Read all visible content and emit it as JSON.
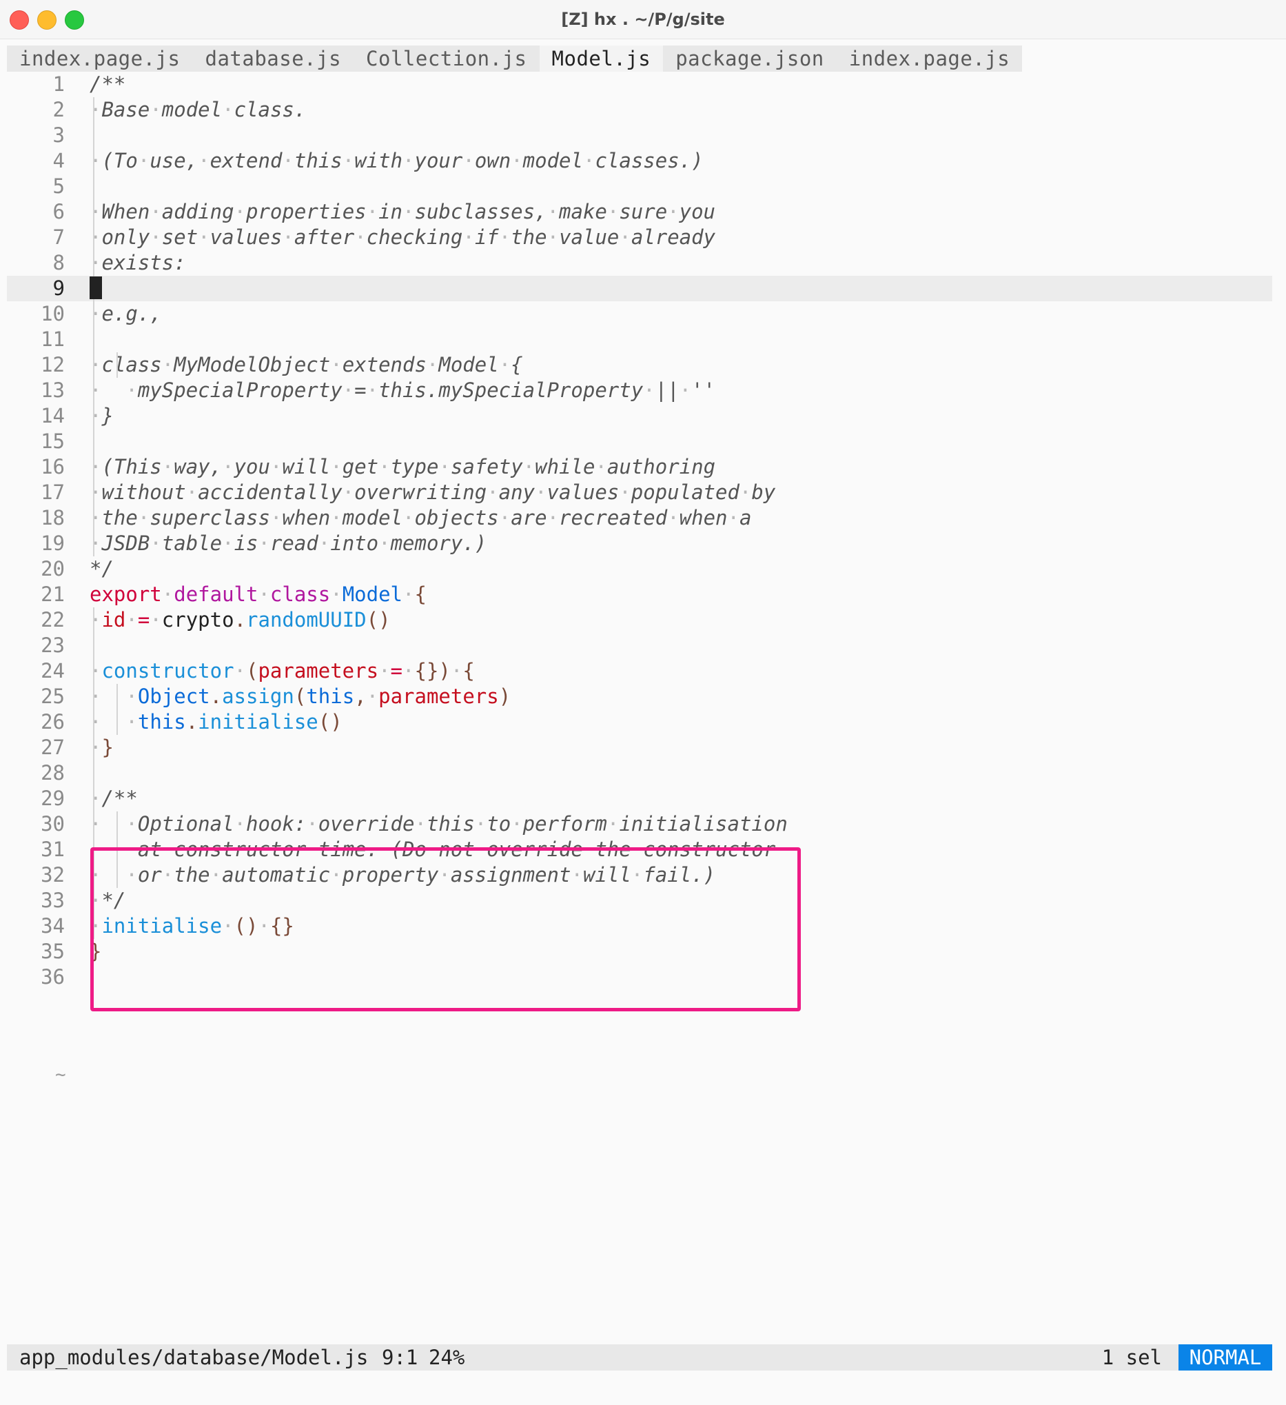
{
  "window": {
    "title": "[Z] hx . ~/P/g/site"
  },
  "tabs": [
    {
      "label": "index.page.js",
      "active": false
    },
    {
      "label": "database.js",
      "active": false
    },
    {
      "label": "Collection.js",
      "active": false
    },
    {
      "label": "Model.js",
      "active": true
    },
    {
      "label": "package.json",
      "active": false
    },
    {
      "label": "index.page.js",
      "active": false
    }
  ],
  "editor": {
    "cursor_line": 9,
    "line_numbers": [
      "1",
      "2",
      "3",
      "4",
      "5",
      "6",
      "7",
      "8",
      "9",
      "10",
      "11",
      "12",
      "13",
      "14",
      "15",
      "16",
      "17",
      "18",
      "19",
      "20",
      "21",
      "22",
      "23",
      "24",
      "25",
      "26",
      "27",
      "28",
      "29",
      "30",
      "31",
      "32",
      "33",
      "34",
      "35",
      "36"
    ],
    "empty_marker": "~",
    "lines": [
      [
        {
          "t": "/**",
          "c": "comment"
        }
      ],
      [
        {
          "t": "·",
          "c": "ws"
        },
        {
          "t": "Base",
          "c": "comment"
        },
        {
          "t": "·",
          "c": "ws"
        },
        {
          "t": "model",
          "c": "comment"
        },
        {
          "t": "·",
          "c": "ws"
        },
        {
          "t": "class.",
          "c": "comment"
        }
      ],
      [],
      [
        {
          "t": "·",
          "c": "ws"
        },
        {
          "t": "(To",
          "c": "comment"
        },
        {
          "t": "·",
          "c": "ws"
        },
        {
          "t": "use,",
          "c": "comment"
        },
        {
          "t": "·",
          "c": "ws"
        },
        {
          "t": "extend",
          "c": "comment"
        },
        {
          "t": "·",
          "c": "ws"
        },
        {
          "t": "this",
          "c": "comment"
        },
        {
          "t": "·",
          "c": "ws"
        },
        {
          "t": "with",
          "c": "comment"
        },
        {
          "t": "·",
          "c": "ws"
        },
        {
          "t": "your",
          "c": "comment"
        },
        {
          "t": "·",
          "c": "ws"
        },
        {
          "t": "own",
          "c": "comment"
        },
        {
          "t": "·",
          "c": "ws"
        },
        {
          "t": "model",
          "c": "comment"
        },
        {
          "t": "·",
          "c": "ws"
        },
        {
          "t": "classes.)",
          "c": "comment"
        }
      ],
      [],
      [
        {
          "t": "·",
          "c": "ws"
        },
        {
          "t": "When",
          "c": "comment"
        },
        {
          "t": "·",
          "c": "ws"
        },
        {
          "t": "adding",
          "c": "comment"
        },
        {
          "t": "·",
          "c": "ws"
        },
        {
          "t": "properties",
          "c": "comment"
        },
        {
          "t": "·",
          "c": "ws"
        },
        {
          "t": "in",
          "c": "comment"
        },
        {
          "t": "·",
          "c": "ws"
        },
        {
          "t": "subclasses,",
          "c": "comment"
        },
        {
          "t": "·",
          "c": "ws"
        },
        {
          "t": "make",
          "c": "comment"
        },
        {
          "t": "·",
          "c": "ws"
        },
        {
          "t": "sure",
          "c": "comment"
        },
        {
          "t": "·",
          "c": "ws"
        },
        {
          "t": "you",
          "c": "comment"
        }
      ],
      [
        {
          "t": "·",
          "c": "ws"
        },
        {
          "t": "only",
          "c": "comment"
        },
        {
          "t": "·",
          "c": "ws"
        },
        {
          "t": "set",
          "c": "comment"
        },
        {
          "t": "·",
          "c": "ws"
        },
        {
          "t": "values",
          "c": "comment"
        },
        {
          "t": "·",
          "c": "ws"
        },
        {
          "t": "after",
          "c": "comment"
        },
        {
          "t": "·",
          "c": "ws"
        },
        {
          "t": "checking",
          "c": "comment"
        },
        {
          "t": "·",
          "c": "ws"
        },
        {
          "t": "if",
          "c": "comment"
        },
        {
          "t": "·",
          "c": "ws"
        },
        {
          "t": "the",
          "c": "comment"
        },
        {
          "t": "·",
          "c": "ws"
        },
        {
          "t": "value",
          "c": "comment"
        },
        {
          "t": "·",
          "c": "ws"
        },
        {
          "t": "already",
          "c": "comment"
        }
      ],
      [
        {
          "t": "·",
          "c": "ws"
        },
        {
          "t": "exists:",
          "c": "comment"
        }
      ],
      [],
      [
        {
          "t": "·",
          "c": "ws"
        },
        {
          "t": "e.g.,",
          "c": "comment"
        }
      ],
      [],
      [
        {
          "t": "·",
          "c": "ws"
        },
        {
          "t": "class",
          "c": "comment"
        },
        {
          "t": "·",
          "c": "ws"
        },
        {
          "t": "MyModelObject",
          "c": "comment"
        },
        {
          "t": "·",
          "c": "ws"
        },
        {
          "t": "extends",
          "c": "comment"
        },
        {
          "t": "·",
          "c": "ws"
        },
        {
          "t": "Model",
          "c": "comment"
        },
        {
          "t": "·",
          "c": "ws"
        },
        {
          "t": "{",
          "c": "comment"
        }
      ],
      [
        {
          "t": "·",
          "c": "ws"
        },
        {
          "t": "  ",
          "c": "ws"
        },
        {
          "t": "·",
          "c": "ws"
        },
        {
          "t": "mySpecialProperty",
          "c": "comment"
        },
        {
          "t": "·",
          "c": "ws"
        },
        {
          "t": "=",
          "c": "comment"
        },
        {
          "t": "·",
          "c": "ws"
        },
        {
          "t": "this.mySpecialProperty",
          "c": "comment"
        },
        {
          "t": "·",
          "c": "ws"
        },
        {
          "t": "||",
          "c": "comment"
        },
        {
          "t": "·",
          "c": "ws"
        },
        {
          "t": "''",
          "c": "comment"
        }
      ],
      [
        {
          "t": "·",
          "c": "ws"
        },
        {
          "t": "}",
          "c": "comment"
        }
      ],
      [],
      [
        {
          "t": "·",
          "c": "ws"
        },
        {
          "t": "(This",
          "c": "comment"
        },
        {
          "t": "·",
          "c": "ws"
        },
        {
          "t": "way,",
          "c": "comment"
        },
        {
          "t": "·",
          "c": "ws"
        },
        {
          "t": "you",
          "c": "comment"
        },
        {
          "t": "·",
          "c": "ws"
        },
        {
          "t": "will",
          "c": "comment"
        },
        {
          "t": "·",
          "c": "ws"
        },
        {
          "t": "get",
          "c": "comment"
        },
        {
          "t": "·",
          "c": "ws"
        },
        {
          "t": "type",
          "c": "comment"
        },
        {
          "t": "·",
          "c": "ws"
        },
        {
          "t": "safety",
          "c": "comment"
        },
        {
          "t": "·",
          "c": "ws"
        },
        {
          "t": "while",
          "c": "comment"
        },
        {
          "t": "·",
          "c": "ws"
        },
        {
          "t": "authoring",
          "c": "comment"
        }
      ],
      [
        {
          "t": "·",
          "c": "ws"
        },
        {
          "t": "without",
          "c": "comment"
        },
        {
          "t": "·",
          "c": "ws"
        },
        {
          "t": "accidentally",
          "c": "comment"
        },
        {
          "t": "·",
          "c": "ws"
        },
        {
          "t": "overwriting",
          "c": "comment"
        },
        {
          "t": "·",
          "c": "ws"
        },
        {
          "t": "any",
          "c": "comment"
        },
        {
          "t": "·",
          "c": "ws"
        },
        {
          "t": "values",
          "c": "comment"
        },
        {
          "t": "·",
          "c": "ws"
        },
        {
          "t": "populated",
          "c": "comment"
        },
        {
          "t": "·",
          "c": "ws"
        },
        {
          "t": "by",
          "c": "comment"
        }
      ],
      [
        {
          "t": "·",
          "c": "ws"
        },
        {
          "t": "the",
          "c": "comment"
        },
        {
          "t": "·",
          "c": "ws"
        },
        {
          "t": "superclass",
          "c": "comment"
        },
        {
          "t": "·",
          "c": "ws"
        },
        {
          "t": "when",
          "c": "comment"
        },
        {
          "t": "·",
          "c": "ws"
        },
        {
          "t": "model",
          "c": "comment"
        },
        {
          "t": "·",
          "c": "ws"
        },
        {
          "t": "objects",
          "c": "comment"
        },
        {
          "t": "·",
          "c": "ws"
        },
        {
          "t": "are",
          "c": "comment"
        },
        {
          "t": "·",
          "c": "ws"
        },
        {
          "t": "recreated",
          "c": "comment"
        },
        {
          "t": "·",
          "c": "ws"
        },
        {
          "t": "when",
          "c": "comment"
        },
        {
          "t": "·",
          "c": "ws"
        },
        {
          "t": "a",
          "c": "comment"
        }
      ],
      [
        {
          "t": "·",
          "c": "ws"
        },
        {
          "t": "JSDB",
          "c": "comment"
        },
        {
          "t": "·",
          "c": "ws"
        },
        {
          "t": "table",
          "c": "comment"
        },
        {
          "t": "·",
          "c": "ws"
        },
        {
          "t": "is",
          "c": "comment"
        },
        {
          "t": "·",
          "c": "ws"
        },
        {
          "t": "read",
          "c": "comment"
        },
        {
          "t": "·",
          "c": "ws"
        },
        {
          "t": "into",
          "c": "comment"
        },
        {
          "t": "·",
          "c": "ws"
        },
        {
          "t": "memory.)",
          "c": "comment"
        }
      ],
      [
        {
          "t": "*/",
          "c": "comment"
        }
      ],
      [
        {
          "t": "export",
          "c": "kw"
        },
        {
          "t": "·",
          "c": "ws"
        },
        {
          "t": "default",
          "c": "kw2"
        },
        {
          "t": "·",
          "c": "ws"
        },
        {
          "t": "class",
          "c": "kw2"
        },
        {
          "t": "·",
          "c": "ws"
        },
        {
          "t": "Model",
          "c": "cls"
        },
        {
          "t": "·",
          "c": "ws"
        },
        {
          "t": "{",
          "c": "punct"
        }
      ],
      [
        {
          "t": "·",
          "c": "ws"
        },
        {
          "t": "id",
          "c": "param"
        },
        {
          "t": "·",
          "c": "ws"
        },
        {
          "t": "=",
          "c": "kw"
        },
        {
          "t": "·",
          "c": "ws"
        },
        {
          "t": "crypto",
          "c": "plain"
        },
        {
          "t": ".",
          "c": "punct"
        },
        {
          "t": "randomUUID",
          "c": "fn"
        },
        {
          "t": "()",
          "c": "punct"
        }
      ],
      [],
      [
        {
          "t": "·",
          "c": "ws"
        },
        {
          "t": "constructor",
          "c": "fn"
        },
        {
          "t": "·",
          "c": "ws"
        },
        {
          "t": "(",
          "c": "punct"
        },
        {
          "t": "parameters",
          "c": "param"
        },
        {
          "t": "·",
          "c": "ws"
        },
        {
          "t": "=",
          "c": "kw"
        },
        {
          "t": "·",
          "c": "ws"
        },
        {
          "t": "{})",
          "c": "punct"
        },
        {
          "t": "·",
          "c": "ws"
        },
        {
          "t": "{",
          "c": "punct"
        }
      ],
      [
        {
          "t": "·",
          "c": "ws"
        },
        {
          "t": "  ",
          "c": "ws"
        },
        {
          "t": "·",
          "c": "ws"
        },
        {
          "t": "Object",
          "c": "cls"
        },
        {
          "t": ".",
          "c": "punct"
        },
        {
          "t": "assign",
          "c": "fn"
        },
        {
          "t": "(",
          "c": "punct"
        },
        {
          "t": "this",
          "c": "cls"
        },
        {
          "t": ",",
          "c": "punct"
        },
        {
          "t": "·",
          "c": "ws"
        },
        {
          "t": "parameters",
          "c": "param"
        },
        {
          "t": ")",
          "c": "punct"
        }
      ],
      [
        {
          "t": "·",
          "c": "ws"
        },
        {
          "t": "  ",
          "c": "ws"
        },
        {
          "t": "·",
          "c": "ws"
        },
        {
          "t": "this",
          "c": "cls"
        },
        {
          "t": ".",
          "c": "punct"
        },
        {
          "t": "initialise",
          "c": "fn"
        },
        {
          "t": "()",
          "c": "punct"
        }
      ],
      [
        {
          "t": "·",
          "c": "ws"
        },
        {
          "t": "}",
          "c": "punct"
        }
      ],
      [],
      [
        {
          "t": "·",
          "c": "ws"
        },
        {
          "t": "/**",
          "c": "comment"
        }
      ],
      [
        {
          "t": "·",
          "c": "ws"
        },
        {
          "t": "  ",
          "c": "ws"
        },
        {
          "t": "·",
          "c": "ws"
        },
        {
          "t": "Optional",
          "c": "comment"
        },
        {
          "t": "·",
          "c": "ws"
        },
        {
          "t": "hook:",
          "c": "comment"
        },
        {
          "t": "·",
          "c": "ws"
        },
        {
          "t": "override",
          "c": "comment"
        },
        {
          "t": "·",
          "c": "ws"
        },
        {
          "t": "this",
          "c": "comment"
        },
        {
          "t": "·",
          "c": "ws"
        },
        {
          "t": "to",
          "c": "comment"
        },
        {
          "t": "·",
          "c": "ws"
        },
        {
          "t": "perform",
          "c": "comment"
        },
        {
          "t": "·",
          "c": "ws"
        },
        {
          "t": "initialisation",
          "c": "comment"
        }
      ],
      [
        {
          "t": "·",
          "c": "ws"
        },
        {
          "t": "  ",
          "c": "ws"
        },
        {
          "t": "·",
          "c": "ws"
        },
        {
          "t": "at",
          "c": "comment"
        },
        {
          "t": "·",
          "c": "ws"
        },
        {
          "t": "constructor",
          "c": "comment"
        },
        {
          "t": "·",
          "c": "ws"
        },
        {
          "t": "time.",
          "c": "comment"
        },
        {
          "t": "·",
          "c": "ws"
        },
        {
          "t": "(Do",
          "c": "comment"
        },
        {
          "t": "·",
          "c": "ws"
        },
        {
          "t": "not",
          "c": "comment"
        },
        {
          "t": "·",
          "c": "ws"
        },
        {
          "t": "override",
          "c": "comment"
        },
        {
          "t": "·",
          "c": "ws"
        },
        {
          "t": "the",
          "c": "comment"
        },
        {
          "t": "·",
          "c": "ws"
        },
        {
          "t": "constructor",
          "c": "comment"
        }
      ],
      [
        {
          "t": "·",
          "c": "ws"
        },
        {
          "t": "  ",
          "c": "ws"
        },
        {
          "t": "·",
          "c": "ws"
        },
        {
          "t": "or",
          "c": "comment"
        },
        {
          "t": "·",
          "c": "ws"
        },
        {
          "t": "the",
          "c": "comment"
        },
        {
          "t": "·",
          "c": "ws"
        },
        {
          "t": "automatic",
          "c": "comment"
        },
        {
          "t": "·",
          "c": "ws"
        },
        {
          "t": "property",
          "c": "comment"
        },
        {
          "t": "·",
          "c": "ws"
        },
        {
          "t": "assignment",
          "c": "comment"
        },
        {
          "t": "·",
          "c": "ws"
        },
        {
          "t": "will",
          "c": "comment"
        },
        {
          "t": "·",
          "c": "ws"
        },
        {
          "t": "fail.)",
          "c": "comment"
        }
      ],
      [
        {
          "t": "·",
          "c": "ws"
        },
        {
          "t": "*/",
          "c": "comment"
        }
      ],
      [
        {
          "t": "·",
          "c": "ws"
        },
        {
          "t": "initialise",
          "c": "fn"
        },
        {
          "t": "·",
          "c": "ws"
        },
        {
          "t": "()",
          "c": "punct"
        },
        {
          "t": "·",
          "c": "ws"
        },
        {
          "t": "{}",
          "c": "punct"
        }
      ],
      [
        {
          "t": "}",
          "c": "punct"
        }
      ],
      []
    ]
  },
  "statusbar": {
    "file": "app_modules/database/Model.js",
    "position": "9:1",
    "percent": "24%",
    "selections": "1 sel",
    "mode": "NORMAL"
  },
  "colors": {
    "highlight_box": "#ee1b86",
    "mode_badge": "#0a84e8"
  }
}
